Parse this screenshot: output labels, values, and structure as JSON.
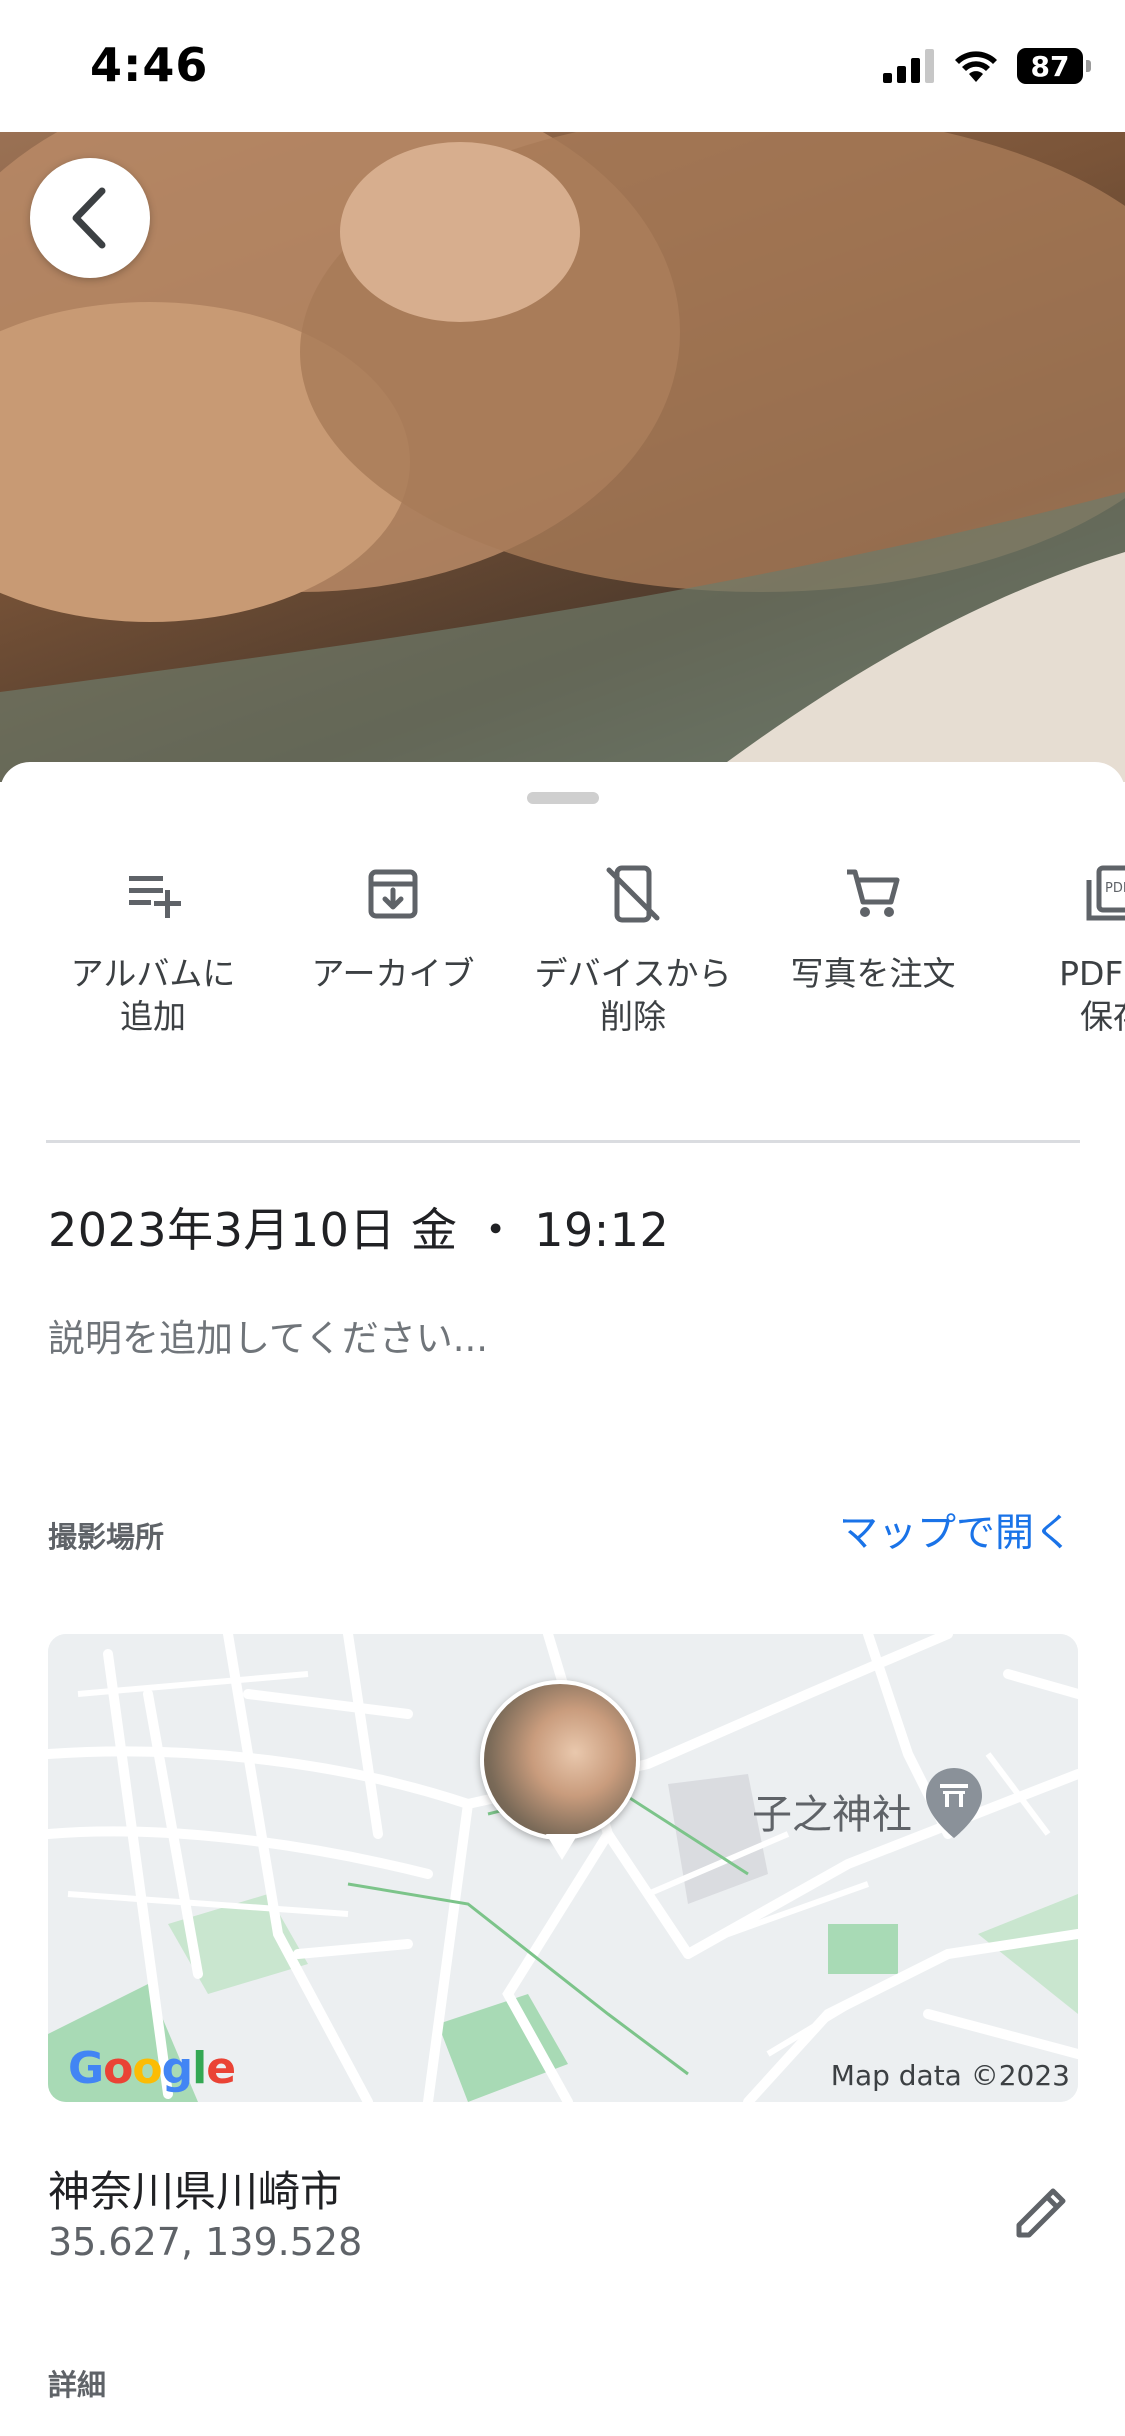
{
  "status_bar": {
    "time": "4:46",
    "battery": "87"
  },
  "actions": [
    {
      "label": "アルバムに\n追加",
      "icon": "playlist-add-icon"
    },
    {
      "label": "アーカイブ",
      "icon": "archive-icon"
    },
    {
      "label": "デバイスから\n削除",
      "icon": "phone-off-icon"
    },
    {
      "label": "写真を注文",
      "icon": "cart-icon"
    },
    {
      "label": "PDF 形\n保存",
      "icon": "pdf-icon"
    }
  ],
  "details": {
    "date": "2023年3月10日 金 ・ 19:12",
    "description_placeholder": "説明を追加してください..."
  },
  "location": {
    "section_label": "撮影場所",
    "open_map_link": "マップで開く",
    "map_credit": "Map data ©2023",
    "map_logo": "Google",
    "map_poi": "子之神社",
    "place_name": "神奈川県川崎市",
    "coords": "35.627, 139.528"
  },
  "more": {
    "section_label": "詳細"
  },
  "colors": {
    "accent": "#1a73e8",
    "map_bg": "#eceff1",
    "park": "#a8dab5"
  }
}
